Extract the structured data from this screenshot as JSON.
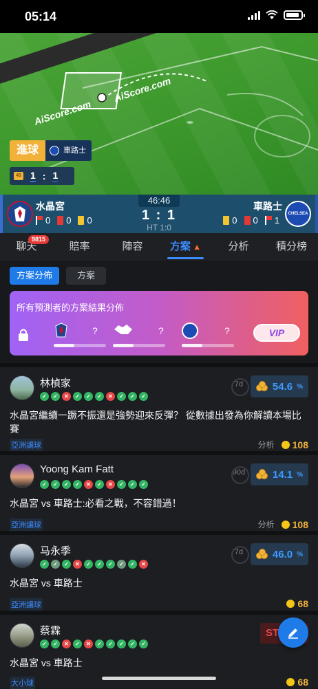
{
  "status": {
    "time": "05:14"
  },
  "pitch": {
    "brand": "AiScore.com",
    "goal_label": "進球",
    "goal_team": "車路士",
    "mini_minute": "45",
    "mini_score_home": "1",
    "mini_score_away": "1",
    "mini_sep": ":"
  },
  "match": {
    "clock": "46:46",
    "score": "1 : 1",
    "ht": "HT 1:0",
    "home": {
      "name": "水晶宮",
      "corners": "0",
      "red": "0",
      "yellow": "0"
    },
    "away": {
      "name": "車路士",
      "yellow": "0",
      "red": "0",
      "corners": "1",
      "crest_text": "CHELSEA"
    }
  },
  "tabs": [
    {
      "label": "聊天",
      "badge": "9815"
    },
    {
      "label": "賠率"
    },
    {
      "label": "陣容"
    },
    {
      "label": "方案",
      "icon": "fire-icon",
      "active": true
    },
    {
      "label": "分析"
    },
    {
      "label": "積分榜"
    }
  ],
  "subtabs": [
    "方案分佈",
    "方案"
  ],
  "promo": {
    "title": "所有預測者的方案結果分佈",
    "q1": "?",
    "q2": "?",
    "q3": "?",
    "vip": "VIP"
  },
  "posts": [
    {
      "name": "林楨家",
      "results": [
        "w",
        "w",
        "l",
        "w",
        "w",
        "w",
        "l",
        "w",
        "w",
        "w"
      ],
      "days": "7d",
      "rate": "54.6",
      "rate_unit": "%",
      "title": "水晶宮繼續一蹶不振還是強勢迎來反彈？ 從數據出發為你解讀本場比賽",
      "tag": "亞洲讓球",
      "meta_label": "分析",
      "price": "108"
    },
    {
      "name": "Yoong Kam Fatt",
      "results": [
        "w",
        "w",
        "w",
        "w",
        "l",
        "w",
        "l",
        "w",
        "w",
        "w"
      ],
      "days": "90d",
      "rate": "14.1",
      "rate_unit": "%",
      "title": "水晶宮 vs 車路士:必看之戰，不容錯過！",
      "tag": "亞洲讓球",
      "meta_label": "分析",
      "price": "108"
    },
    {
      "name": "马永季",
      "results": [
        "w",
        "d",
        "w",
        "l",
        "w",
        "w",
        "w",
        "d",
        "w",
        "l"
      ],
      "days": "7d",
      "rate": "46.0",
      "rate_unit": "%",
      "title": "水晶宮 vs 車路士",
      "tag": "亞洲讓球",
      "meta_label": "",
      "price": "68"
    },
    {
      "name": "蔡霖",
      "results": [
        "w",
        "w",
        "l",
        "w",
        "l",
        "w",
        "w",
        "w",
        "w",
        "w"
      ],
      "days": "",
      "rate": "STOP",
      "title": "水晶宮 vs 車路士",
      "tag": "大小球",
      "meta_label": "",
      "price": "68"
    }
  ]
}
